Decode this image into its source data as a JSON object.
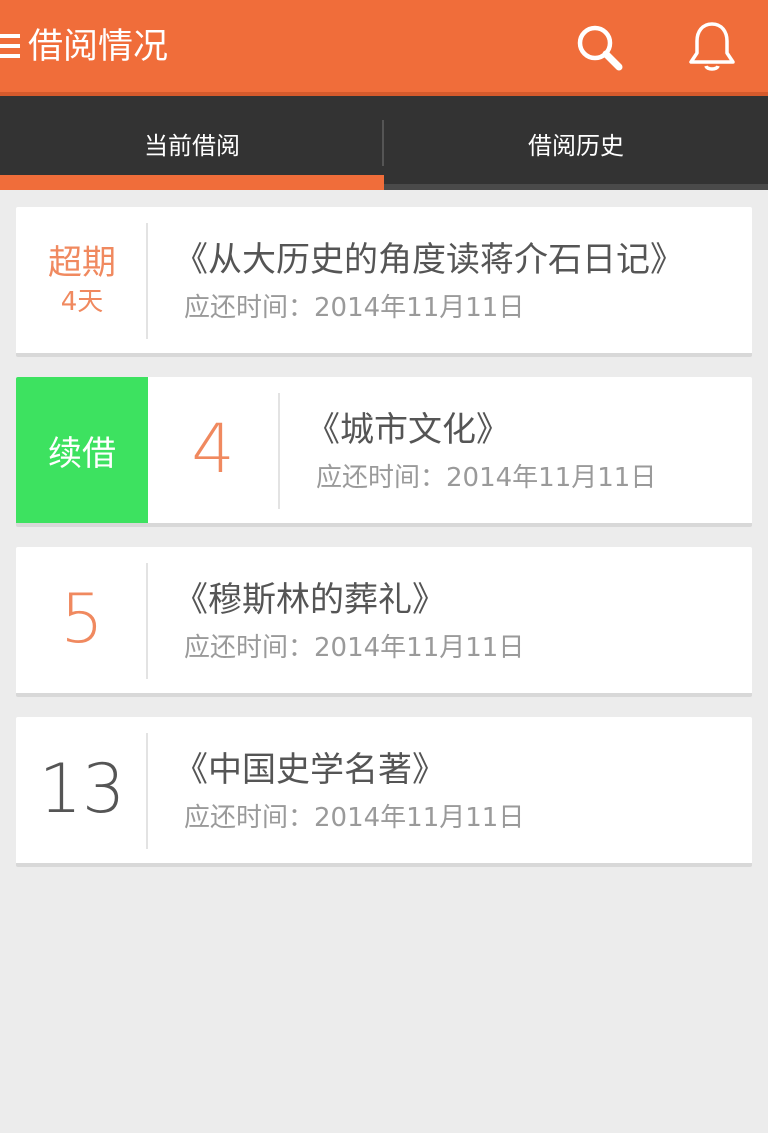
{
  "header": {
    "title": "借阅情况",
    "menu_icon": "menu-icon",
    "search_icon": "search-icon",
    "bell_icon": "bell-icon",
    "color": "#f06d3a"
  },
  "tabs": [
    {
      "label": "当前借阅",
      "active": true
    },
    {
      "label": "借阅历史",
      "active": false
    }
  ],
  "loans": [
    {
      "status": "超期",
      "status_detail": "4天",
      "title": "《从大历史的角度读蒋介石日记》",
      "due": "应还时间：2014年11月11日"
    },
    {
      "action_label": "续借",
      "days": "4",
      "title": "《城市文化》",
      "due": "应还时间：2014年11月11日"
    },
    {
      "days": "5",
      "title": "《穆斯林的葬礼》",
      "due": "应还时间：2014年11月11日"
    },
    {
      "days": "13",
      "title": "《中国史学名著》",
      "due": "应还时间：2014年11月11日"
    }
  ],
  "colors": {
    "accent": "#f06d3a",
    "overdue": "#f0895f",
    "renew": "#3de260",
    "tab_bar": "#333333"
  }
}
